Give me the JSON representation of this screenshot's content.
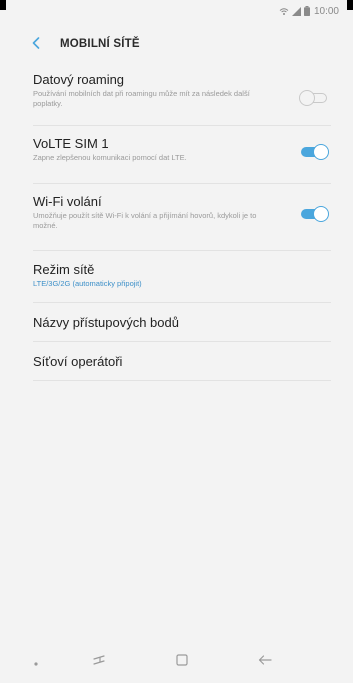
{
  "status_bar": {
    "time": "10:00",
    "icons": [
      "wifi-calling-icon",
      "signal-icon",
      "battery-icon"
    ]
  },
  "header": {
    "title": "MOBILNÍ SÍTĚ",
    "back_icon": "back-arrow-icon"
  },
  "settings": {
    "data_roaming": {
      "title": "Datový roaming",
      "subtitle": "Používání mobilních dat při roamingu může mít za následek další poplatky.",
      "enabled": false
    },
    "volte": {
      "title": "VoLTE SIM 1",
      "subtitle": "Zapne zlepšenou komunikaci pomocí dat LTE.",
      "enabled": true
    },
    "wifi_calling": {
      "title": "Wi-Fi volání",
      "subtitle": "Umožňuje použít sítě Wi-Fi k volání a přijímání hovorů, kdykoli je to možné.",
      "enabled": true
    },
    "network_mode": {
      "title": "Režim sítě",
      "value": "LTE/3G/2G (automaticky připojit)"
    },
    "access_point_names": {
      "title": "Názvy přístupových bodů"
    },
    "network_operators": {
      "title": "Síťoví operátoři"
    }
  },
  "nav_bar": {
    "icons": [
      "dot-icon",
      "recent-apps-icon",
      "home-icon",
      "back-icon"
    ]
  },
  "colors": {
    "accent": "#4aa6dd",
    "accent_text": "#3c8fc8",
    "background": "#f3f3f3"
  }
}
